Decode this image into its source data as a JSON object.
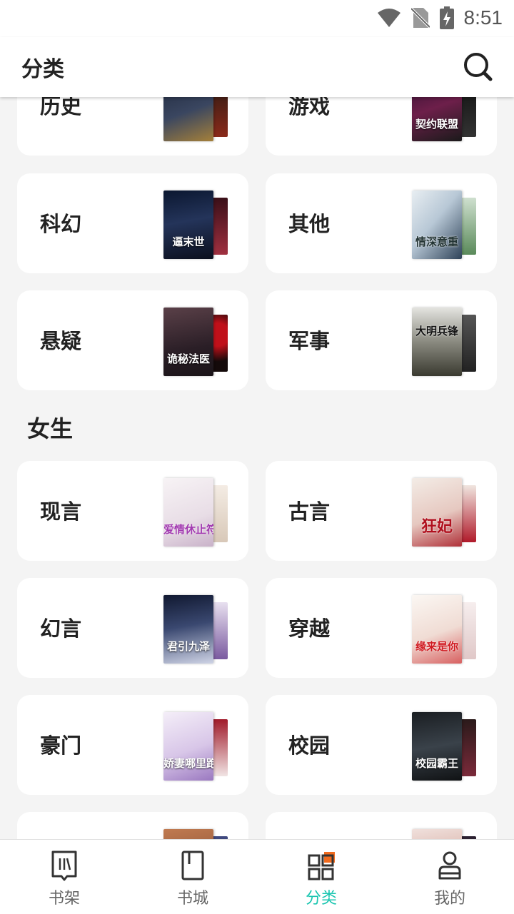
{
  "status": {
    "time": "8:51"
  },
  "appbar": {
    "title": "分类"
  },
  "male_categories": [
    {
      "label": "历史",
      "cover_text": ""
    },
    {
      "label": "游戏",
      "cover_text": "契约联盟"
    },
    {
      "label": "科幻",
      "cover_text": "逼末世"
    },
    {
      "label": "其他",
      "cover_text": "情深意重"
    },
    {
      "label": "悬疑",
      "cover_text": "诡秘法医"
    },
    {
      "label": "军事",
      "cover_text": "大明兵锋"
    }
  ],
  "female_section": {
    "title": "女生"
  },
  "female_categories": [
    {
      "label": "现言",
      "cover_text": "爱情休止符"
    },
    {
      "label": "古言",
      "cover_text": "狂妃"
    },
    {
      "label": "幻言",
      "cover_text": "君引九泽"
    },
    {
      "label": "穿越",
      "cover_text": "缘来是你"
    },
    {
      "label": "豪门",
      "cover_text": "娇妻哪里跑"
    },
    {
      "label": "校园",
      "cover_text": "校园霸王"
    },
    {
      "label": "",
      "cover_text": ""
    },
    {
      "label": "",
      "cover_text": ""
    }
  ],
  "bottom_nav": [
    {
      "label": "书架",
      "icon": "bookshelf-icon"
    },
    {
      "label": "书城",
      "icon": "bookstore-icon"
    },
    {
      "label": "分类",
      "icon": "category-icon",
      "active": true
    },
    {
      "label": "我的",
      "icon": "profile-icon"
    }
  ],
  "colors": {
    "accent": "#19c5b0",
    "category_badge": "#f06a1e"
  }
}
